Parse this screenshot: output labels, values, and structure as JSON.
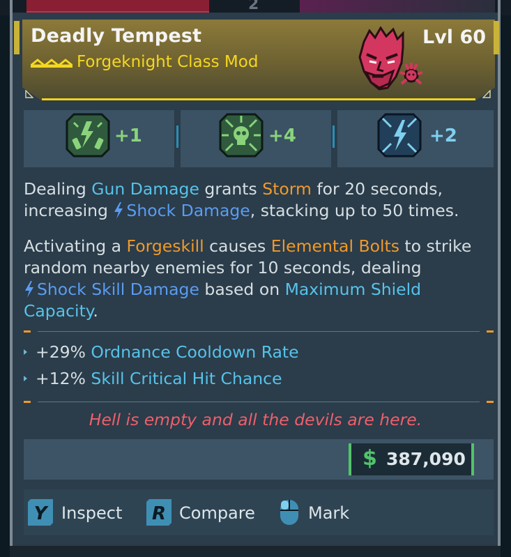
{
  "item": {
    "name": "Deadly Tempest",
    "level": "Lvl 60",
    "type": "Forgeknight Class Mod"
  },
  "skills": [
    {
      "icon": "grenade-burst-icon",
      "bonus": "+1",
      "color": "#8ad37b"
    },
    {
      "icon": "skull-blast-icon",
      "bonus": "+4",
      "color": "#8ad37b"
    },
    {
      "icon": "lightning-cross-icon",
      "bonus": "+2",
      "color": "#7fd0ee"
    }
  ],
  "description": {
    "p1": {
      "t1": "Dealing ",
      "k1": "Gun Damage",
      "t2": " grants ",
      "k2": "Storm",
      "t3": " for 20 seconds,",
      "t4": "increasing ",
      "k3": "Shock Damage",
      "t5": ", stacking up to 50 times."
    },
    "p2": {
      "t1": "Activating a ",
      "k1": "Forgeskill",
      "t2": " causes ",
      "k2": "Elemental Bolts",
      "t3": " to strike",
      "t4": "random nearby enemies for 10 seconds, dealing",
      "k3": "Shock Skill Damage",
      "t5": " based on ",
      "k4": "Maximum Shield",
      "k5": "Capacity",
      "t6": "."
    }
  },
  "stats": [
    {
      "value": "+29%",
      "name": "Ordnance Cooldown Rate"
    },
    {
      "value": "+12%",
      "name": "Skill Critical Hit Chance"
    }
  ],
  "flavor_text": "Hell is empty and all the devils are here.",
  "price": {
    "currency_symbol": "$",
    "value": "387,090"
  },
  "actions": [
    {
      "key": "Y",
      "label": "Inspect"
    },
    {
      "key": "R",
      "label": "Compare"
    },
    {
      "key": "mouse",
      "label": "Mark"
    }
  ],
  "background_tab": {
    "number": "2"
  },
  "colors": {
    "rarity_accent": "#f5d720",
    "keyword_blue": "#56c3ea",
    "keyword_orange": "#f09a2a",
    "shock": "#5a9cf2",
    "flavor": "#ef5f6b",
    "money": "#52c46a"
  }
}
